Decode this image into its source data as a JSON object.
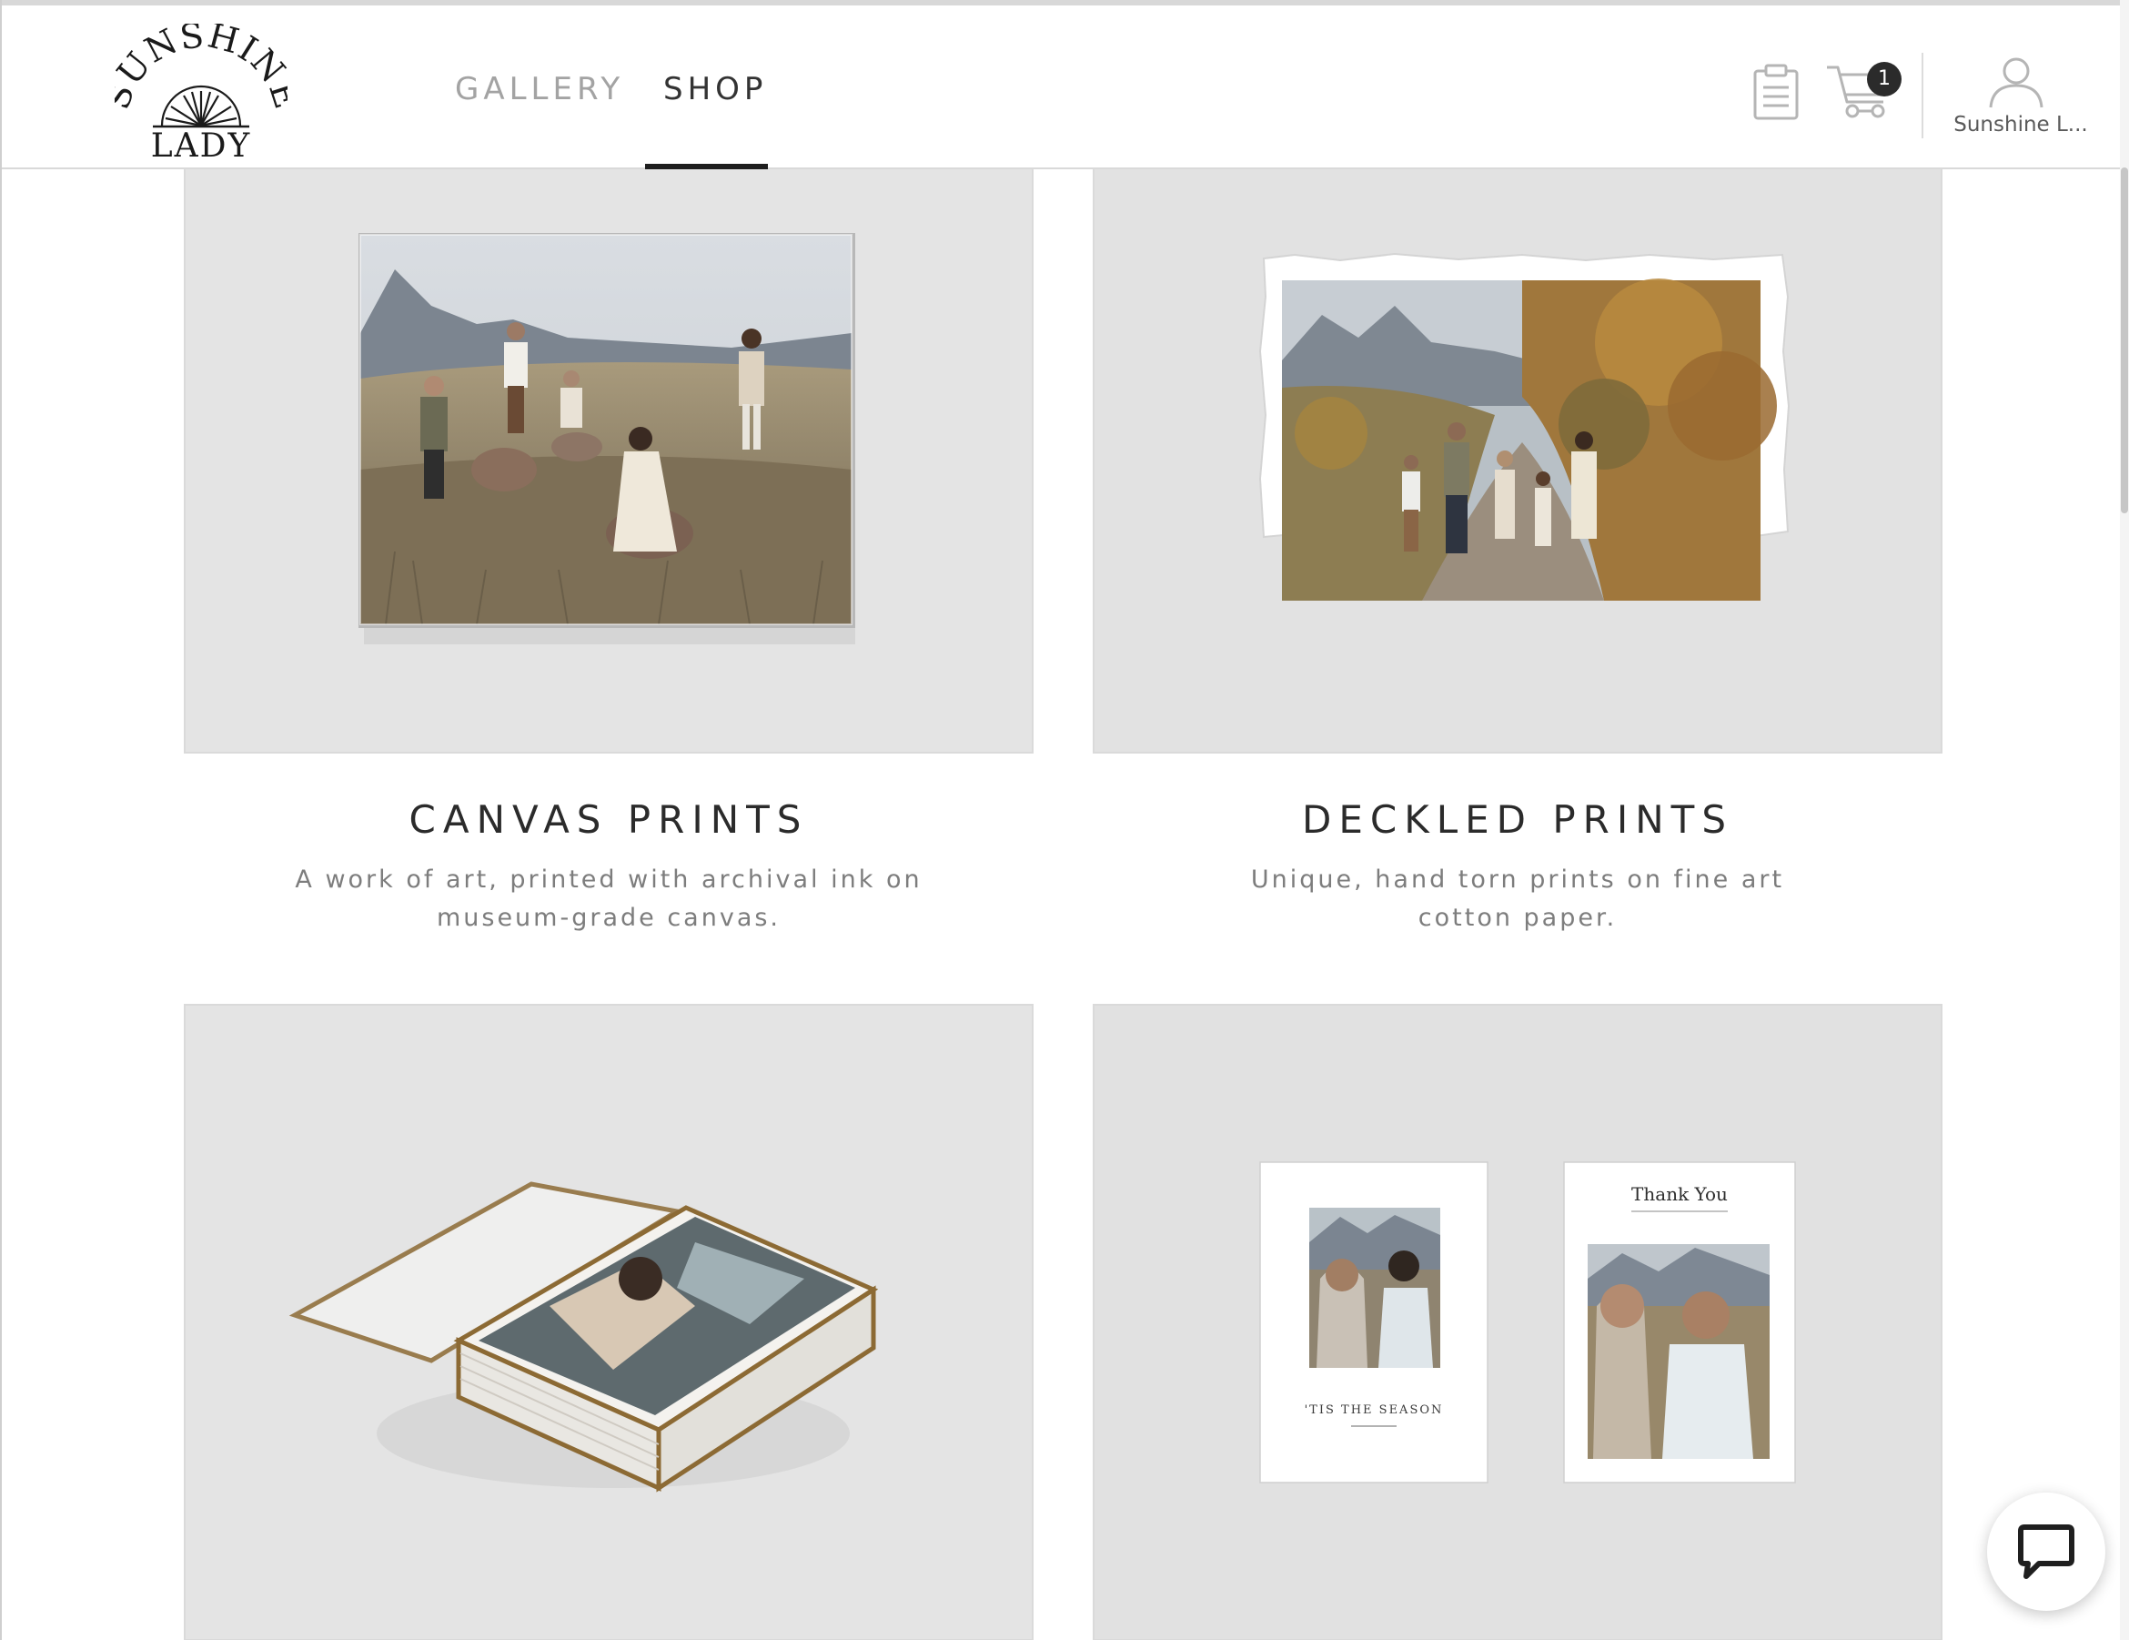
{
  "brand": {
    "logo_top": "SUNSHINE",
    "logo_bottom": "LADY"
  },
  "nav": {
    "items": [
      {
        "label": "GALLERY",
        "active": false
      },
      {
        "label": "SHOP",
        "active": true
      }
    ]
  },
  "header": {
    "clipboard_icon": "clipboard-icon",
    "cart_icon": "cart-icon",
    "cart_count": "1",
    "account_icon": "user-icon",
    "account_name": "Sunshine L..."
  },
  "products": [
    {
      "title": "CANVAS PRINTS",
      "description": "A work of art, printed with archival ink on museum-grade canvas.",
      "image": "family-canvas-photo"
    },
    {
      "title": "DECKLED PRINTS",
      "description": "Unique, hand torn prints on fine art cotton paper.",
      "image": "family-deckled-photo"
    },
    {
      "title": "",
      "description": "",
      "image": "glass-photo-box"
    },
    {
      "title": "",
      "description": "",
      "image": "holiday-cards",
      "card_text": {
        "card1_heading": "'TIS THE SEASON",
        "card2_heading": "Thank You"
      }
    }
  ],
  "chat": {
    "icon": "chat-bubble-icon"
  },
  "colors": {
    "active_nav": "#333333",
    "inactive_nav": "#a3a3a3",
    "tile_bg": "#e3e3e3",
    "badge": "#2b2b2b"
  }
}
